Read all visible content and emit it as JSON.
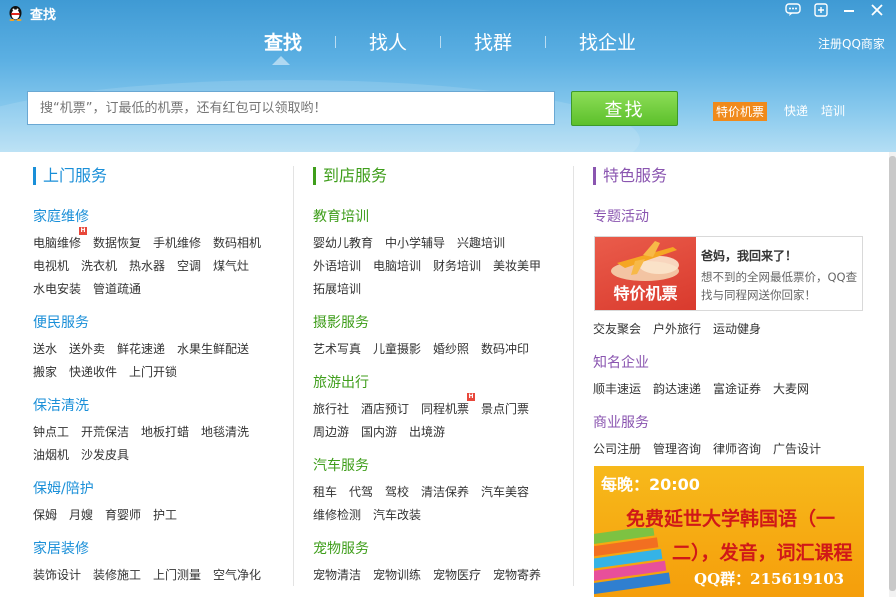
{
  "app": {
    "title": "查找"
  },
  "window_controls": [
    "chat-bubble-icon",
    "pin-icon",
    "minimize-icon",
    "close-icon"
  ],
  "tabs": [
    "查找",
    "找人",
    "找群",
    "找企业"
  ],
  "register_label": "注册QQ商家",
  "search": {
    "placeholder": "搜“机票”，订最低的机票，还有红包可以领取哟！",
    "button_label": "查找"
  },
  "hot_tags": [
    "特价机票",
    "快递",
    "培训"
  ],
  "colors": {
    "header_top": "#3f9ad4",
    "section_blue": "#1a8fd8",
    "section_green": "#3f9e1b",
    "section_purple": "#8a55b0",
    "hot_tag": "#f08a1b",
    "search_button": "#5cc02b"
  },
  "columns": [
    {
      "title": "上门服务",
      "sections": [
        {
          "title": "家庭维修",
          "rows": [
            [
              "电脑维修",
              "数据恢复",
              "手机维修",
              "数码相机"
            ],
            [
              "电视机",
              "洗衣机",
              "热水器",
              "空调",
              "煤气灶"
            ],
            [
              "水电安装",
              "管道疏通"
            ]
          ]
        },
        {
          "title": "便民服务",
          "rows": [
            [
              "送水",
              "送外卖",
              "鲜花速递",
              "水果生鲜配送"
            ],
            [
              "搬家",
              "快递收件",
              "上门开锁"
            ]
          ]
        },
        {
          "title": "保洁清洗",
          "rows": [
            [
              "钟点工",
              "开荒保洁",
              "地板打蜡",
              "地毯清洗"
            ],
            [
              "油烟机",
              "沙发皮具"
            ]
          ]
        },
        {
          "title": "保姆/陪护",
          "rows": [
            [
              "保姆",
              "月嫂",
              "育婴师",
              "护工"
            ]
          ]
        },
        {
          "title": "家居装修",
          "rows": [
            [
              "装饰设计",
              "装修施工",
              "上门测量",
              "空气净化"
            ]
          ]
        }
      ]
    },
    {
      "title": "到店服务",
      "sections": [
        {
          "title": "教育培训",
          "rows": [
            [
              "婴幼儿教育",
              "中小学辅导",
              "兴趣培训"
            ],
            [
              "外语培训",
              "电脑培训",
              "财务培训",
              "美妆美甲"
            ],
            [
              "拓展培训"
            ]
          ]
        },
        {
          "title": "摄影服务",
          "rows": [
            [
              "艺术写真",
              "儿童摄影",
              "婚纱照",
              "数码冲印"
            ]
          ]
        },
        {
          "title": "旅游出行",
          "rows": [
            [
              "旅行社",
              "酒店预订",
              "同程机票",
              "景点门票"
            ],
            [
              "周边游",
              "国内游",
              "出境游"
            ]
          ]
        },
        {
          "title": "汽车服务",
          "rows": [
            [
              "租车",
              "代驾",
              "驾校",
              "清洁保养",
              "汽车美容"
            ],
            [
              "维修检测",
              "汽车改装"
            ]
          ]
        },
        {
          "title": "宠物服务",
          "rows": [
            [
              "宠物清洁",
              "宠物训练",
              "宠物医疗",
              "宠物寄养"
            ]
          ]
        }
      ]
    },
    {
      "title": "特色服务",
      "sections": [
        {
          "title": "专题活动",
          "rows": [
            [
              "交友聚会",
              "户外旅行",
              "运动健身"
            ]
          ]
        },
        {
          "title": "知名企业",
          "rows": [
            [
              "顺丰速运",
              "韵达速递",
              "富途证券",
              "大麦网"
            ]
          ]
        },
        {
          "title": "商业服务",
          "rows": [
            [
              "公司注册",
              "管理咨询",
              "律师咨询",
              "广告设计"
            ]
          ]
        }
      ],
      "promo": {
        "image_label": "特价机票",
        "title": "爸妈，我回来了！",
        "desc": "想不到的全网最低票价，QQ查找与同程网送你回家！"
      },
      "banner": {
        "time": "每晚：20:00",
        "line1": "免费延世大学韩国语（一",
        "line2": "二），发音，词汇课程",
        "qq": "QQ群：215619103"
      }
    }
  ],
  "hot_badge_label": "H"
}
